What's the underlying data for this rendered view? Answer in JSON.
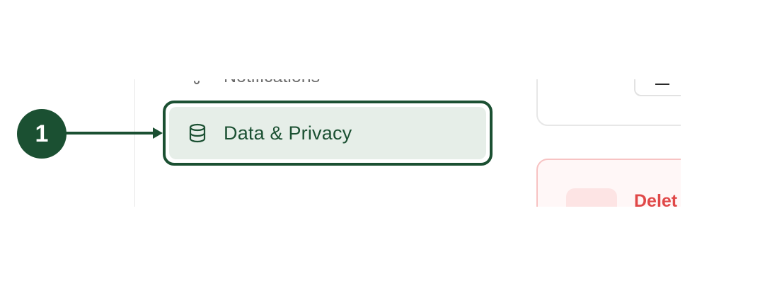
{
  "sidebar": {
    "items": [
      {
        "label": "Notifications",
        "icon": "bell-icon",
        "state": "default"
      },
      {
        "label": "Data & Privacy",
        "icon": "database-icon",
        "state": "active"
      }
    ]
  },
  "danger_zone": {
    "title_partial": "Delet",
    "icon": "trash-icon"
  },
  "annotation": {
    "step_number": "1",
    "color": "#1b5032"
  },
  "colors": {
    "accent": "#1b5032",
    "active_bg": "#e6eee8",
    "danger": "#e04848",
    "danger_bg": "#fff7f7"
  }
}
